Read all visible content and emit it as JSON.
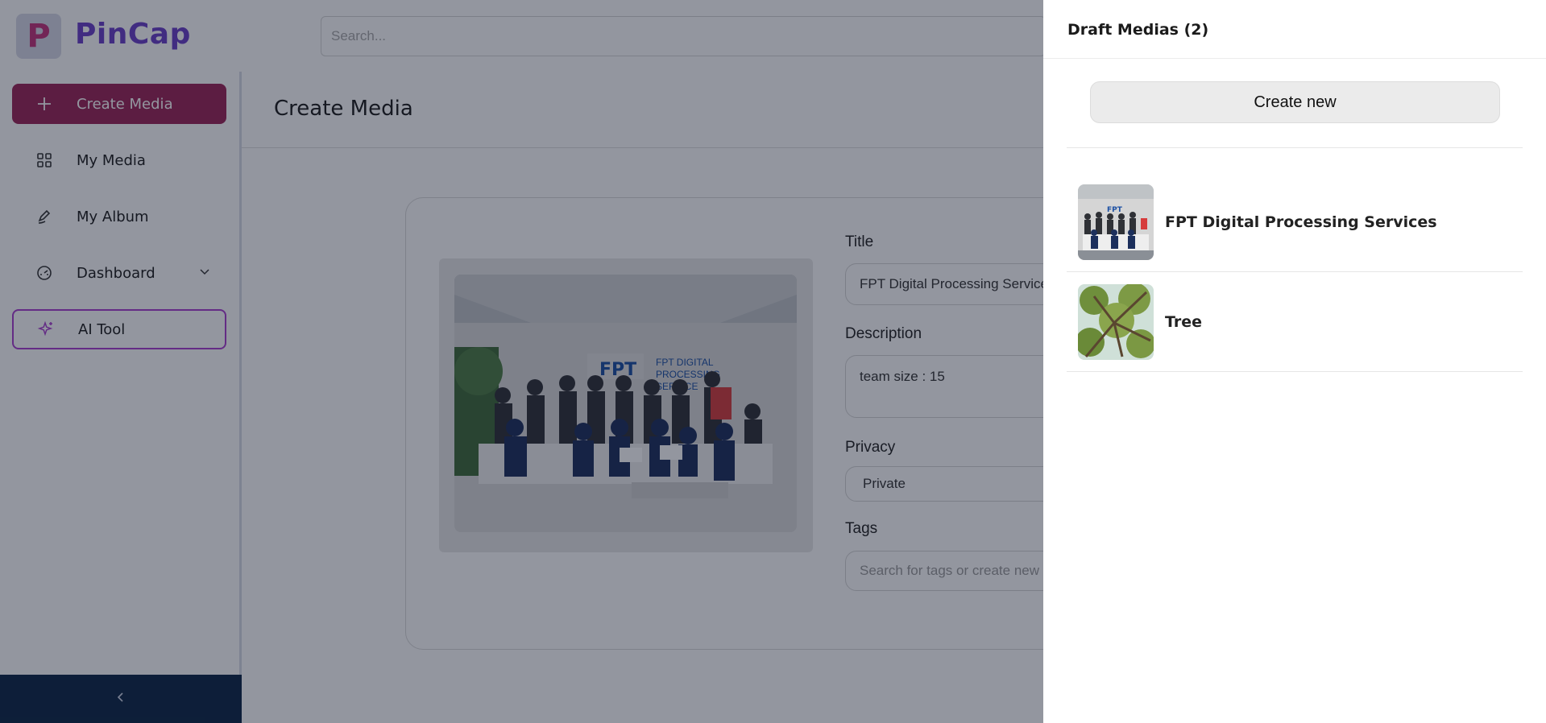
{
  "app": {
    "logo_letter": "P",
    "name": "PinCap"
  },
  "search": {
    "placeholder": "Search..."
  },
  "sidebar": {
    "items": [
      {
        "label": "Create Media",
        "icon": "plus-icon"
      },
      {
        "label": "My Media",
        "icon": "grid-icon"
      },
      {
        "label": "My Album",
        "icon": "pen-icon"
      },
      {
        "label": "Dashboard",
        "icon": "gauge-icon"
      },
      {
        "label": "AI Tool",
        "icon": "sparkle-icon"
      }
    ],
    "collapse_icon": "chevron-left-icon"
  },
  "main": {
    "title": "Create Media",
    "form": {
      "title_label": "Title",
      "title_value": "FPT Digital Processing Services",
      "description_label": "Description",
      "description_value": "team size : 15",
      "privacy_label": "Privacy",
      "privacy_value": "Private",
      "tags_label": "Tags",
      "tags_placeholder": "Search for tags or create new"
    },
    "photo_sign": {
      "logo": "FPT",
      "line1": "FPT DIGITAL",
      "line2": "PROCESSING",
      "line3": "SERVICE"
    }
  },
  "drawer": {
    "title": "Draft Medias (2)",
    "create_button": "Create new",
    "drafts": [
      {
        "name": "FPT Digital Processing Services",
        "thumb": "group-photo"
      },
      {
        "name": "Tree",
        "thumb": "tree-photo"
      }
    ]
  },
  "colors": {
    "accent": "#9c2356",
    "brand": "#6b3ec9",
    "overlay": "rgba(15,23,42,0.45)",
    "collapse_bar": "#0b2545"
  }
}
